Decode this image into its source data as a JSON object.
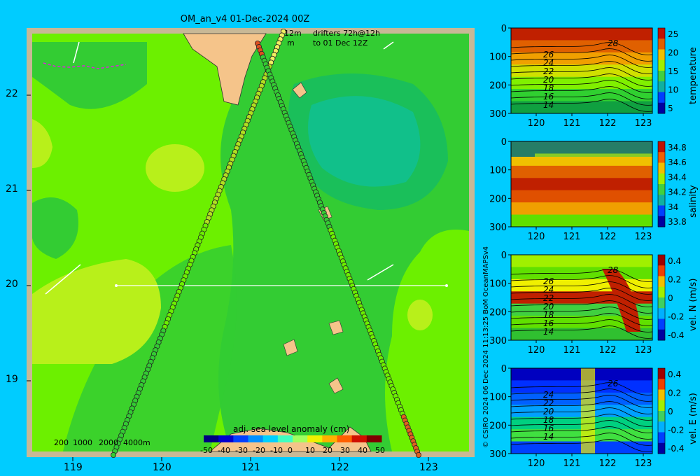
{
  "map": {
    "title": "OM_an_v4  01-Dec-2024 00Z",
    "lat_ticks": [
      "22",
      "21",
      "20",
      "19"
    ],
    "lon_ticks": [
      "119",
      "120",
      "121",
      "122",
      "123"
    ],
    "depth_legend": [
      "200",
      "1000",
      "2000",
      "4000m"
    ],
    "drifter_legend": {
      "scale_line1": "12m",
      "scale_line2": "m",
      "text_line1": "drifters 72h@12h",
      "text_line2": "to 01 Dec 12Z"
    },
    "colorbar": {
      "label": "adj. sea level anomaly (cm)",
      "ticks": [
        "-50",
        "-40",
        "-30",
        "-20",
        "-10",
        "0",
        "10",
        "20",
        "30",
        "40",
        "50"
      ]
    },
    "colors": {
      "ocean_base": "#6cf000",
      "ocean_mid": "#33cc33",
      "ocean_deep": "#1abf5a",
      "ocean_high": "#b8f01a",
      "land": "#f5c48a",
      "frame": "#c8b896"
    }
  },
  "copyright": "© CSIRO 2024   06 Dec 2024 11:13:25 BoM OceanMAPSv4",
  "panels": [
    {
      "name": "temperature",
      "ylabel": "temperature",
      "y_ticks": [
        "0",
        "100",
        "200",
        "300"
      ],
      "x_ticks": [
        "120",
        "121",
        "122",
        "123"
      ],
      "cbar_ticks": [
        "25",
        "20",
        "15",
        "10",
        "5"
      ],
      "contour_labels": [
        "28",
        "26",
        "24",
        "22",
        "20",
        "18",
        "16",
        "14"
      ]
    },
    {
      "name": "salinity",
      "ylabel": "salinity",
      "y_ticks": [
        "0",
        "100",
        "200",
        "300"
      ],
      "x_ticks": [
        "120",
        "121",
        "122",
        "123"
      ],
      "cbar_ticks": [
        "34.8",
        "34.6",
        "34.4",
        "34.2",
        "34",
        "33.8"
      ],
      "contour_labels": []
    },
    {
      "name": "vel-n",
      "ylabel": "vel. N (m/s)",
      "y_ticks": [
        "0",
        "100",
        "200",
        "300"
      ],
      "x_ticks": [
        "120",
        "121",
        "122",
        "123"
      ],
      "cbar_ticks": [
        "0.4",
        "0.2",
        "0",
        "-0.2",
        "-0.4"
      ],
      "contour_labels": [
        "28",
        "26",
        "24",
        "22",
        "20",
        "18",
        "16",
        "14"
      ]
    },
    {
      "name": "vel-e",
      "ylabel": "vel. E (m/s)",
      "y_ticks": [
        "0",
        "100",
        "200",
        "300"
      ],
      "x_ticks": [
        "120",
        "121",
        "122",
        "123"
      ],
      "cbar_ticks": [
        "0.4",
        "0.2",
        "0",
        "-0.2",
        "-0.4"
      ],
      "contour_labels": [
        "26",
        "24",
        "22",
        "20",
        "18",
        "16",
        "14"
      ]
    }
  ]
}
